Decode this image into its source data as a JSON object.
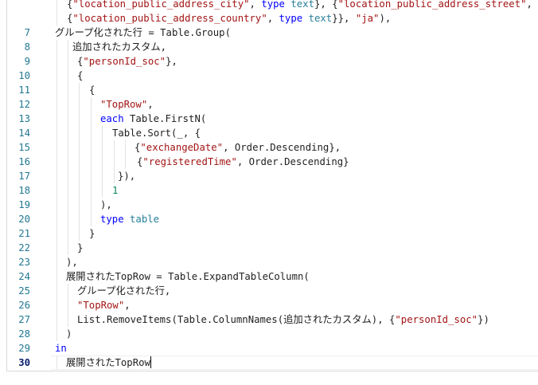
{
  "editor": {
    "current_line": "30",
    "lines": [
      {
        "number": "",
        "indent": 84,
        "tokens": [
          {
            "t": "{",
            "c": "plain"
          },
          {
            "t": "\"location_public_address_city\"",
            "c": "str"
          },
          {
            "t": ", ",
            "c": "plain"
          },
          {
            "t": "type",
            "c": "kw"
          },
          {
            "t": " ",
            "c": "plain"
          },
          {
            "t": "text",
            "c": "type"
          },
          {
            "t": "}, {",
            "c": "plain"
          },
          {
            "t": "\"location_public_address_street\"",
            "c": "str"
          },
          {
            "t": ", ",
            "c": "plain"
          },
          {
            "t": "type",
            "c": "kw"
          },
          {
            "t": " ",
            "c": "plain"
          },
          {
            "t": "text",
            "c": "type"
          },
          {
            "t": "}, {",
            "c": "plain"
          }
        ]
      },
      {
        "number": "",
        "indent": 84,
        "tokens": [
          {
            "t": "{",
            "c": "plain"
          },
          {
            "t": "\"location_public_address_country\"",
            "c": "str"
          },
          {
            "t": ", ",
            "c": "plain"
          },
          {
            "t": "type",
            "c": "kw"
          },
          {
            "t": " ",
            "c": "plain"
          },
          {
            "t": "text",
            "c": "type"
          },
          {
            "t": "}}, ",
            "c": "plain"
          },
          {
            "t": "\"ja\"",
            "c": "str"
          },
          {
            "t": "),",
            "c": "plain"
          }
        ]
      },
      {
        "number": "7",
        "indent": 69,
        "tokens": [
          {
            "t": "グループ化された行 = Table.Group(",
            "c": "plain"
          }
        ]
      },
      {
        "number": "8",
        "indent": 91,
        "tokens": [
          {
            "t": "追加されたカスタム,",
            "c": "plain"
          }
        ]
      },
      {
        "number": "9",
        "indent": 97,
        "tokens": [
          {
            "t": "{",
            "c": "plain"
          },
          {
            "t": "\"personId_soc\"",
            "c": "str"
          },
          {
            "t": "},",
            "c": "plain"
          }
        ]
      },
      {
        "number": "10",
        "indent": 97,
        "tokens": [
          {
            "t": "{",
            "c": "plain"
          }
        ]
      },
      {
        "number": "11",
        "indent": 112,
        "tokens": [
          {
            "t": "{",
            "c": "plain"
          }
        ]
      },
      {
        "number": "12",
        "indent": 126,
        "tokens": [
          {
            "t": "\"TopRow\"",
            "c": "str"
          },
          {
            "t": ",",
            "c": "plain"
          }
        ]
      },
      {
        "number": "13",
        "indent": 126,
        "tokens": [
          {
            "t": "each",
            "c": "kw"
          },
          {
            "t": " Table.FirstN(",
            "c": "plain"
          }
        ]
      },
      {
        "number": "14",
        "indent": 141,
        "tokens": [
          {
            "t": "Table.Sort(_, {",
            "c": "plain"
          }
        ]
      },
      {
        "number": "15",
        "indent": 169,
        "tokens": [
          {
            "t": "{",
            "c": "plain"
          },
          {
            "t": "\"exchangeDate\"",
            "c": "str"
          },
          {
            "t": ", Order.Descending},",
            "c": "plain"
          }
        ]
      },
      {
        "number": "16",
        "indent": 172,
        "tokens": [
          {
            "t": "{",
            "c": "plain"
          },
          {
            "t": "\"registeredTime\"",
            "c": "str"
          },
          {
            "t": ", Order.Descending}",
            "c": "plain"
          }
        ]
      },
      {
        "number": "17",
        "indent": 148,
        "tokens": [
          {
            "t": "}),",
            "c": "plain"
          }
        ]
      },
      {
        "number": "18",
        "indent": 141,
        "tokens": [
          {
            "t": "1",
            "c": "num"
          }
        ]
      },
      {
        "number": "19",
        "indent": 126,
        "tokens": [
          {
            "t": "),",
            "c": "plain"
          }
        ]
      },
      {
        "number": "20",
        "indent": 126,
        "tokens": [
          {
            "t": "type",
            "c": "kw"
          },
          {
            "t": " ",
            "c": "plain"
          },
          {
            "t": "table",
            "c": "type"
          }
        ]
      },
      {
        "number": "21",
        "indent": 112,
        "tokens": [
          {
            "t": "}",
            "c": "plain"
          }
        ]
      },
      {
        "number": "22",
        "indent": 97,
        "tokens": [
          {
            "t": "}",
            "c": "plain"
          }
        ]
      },
      {
        "number": "23",
        "indent": 83,
        "tokens": [
          {
            "t": "),",
            "c": "plain"
          }
        ]
      },
      {
        "number": "24",
        "indent": 83,
        "tokens": [
          {
            "t": "展開されたTopRow = Table.ExpandTableColumn(",
            "c": "plain"
          }
        ]
      },
      {
        "number": "25",
        "indent": 97,
        "tokens": [
          {
            "t": "グループ化された行,",
            "c": "plain"
          }
        ]
      },
      {
        "number": "26",
        "indent": 97,
        "tokens": [
          {
            "t": "\"TopRow\"",
            "c": "str"
          },
          {
            "t": ",",
            "c": "plain"
          }
        ]
      },
      {
        "number": "27",
        "indent": 97,
        "tokens": [
          {
            "t": "List.RemoveItems(Table.ColumnNames(追加されたカスタム), {",
            "c": "plain"
          },
          {
            "t": "\"personId_soc\"",
            "c": "str"
          },
          {
            "t": "})",
            "c": "plain"
          }
        ]
      },
      {
        "number": "28",
        "indent": 83,
        "tokens": [
          {
            "t": ")",
            "c": "plain"
          }
        ]
      },
      {
        "number": "29",
        "indent": 69,
        "tokens": [
          {
            "t": "in",
            "c": "kw"
          }
        ]
      },
      {
        "number": "30",
        "indent": 83,
        "tokens": [
          {
            "t": "展開されたTopRow",
            "c": "plain"
          }
        ]
      }
    ]
  }
}
